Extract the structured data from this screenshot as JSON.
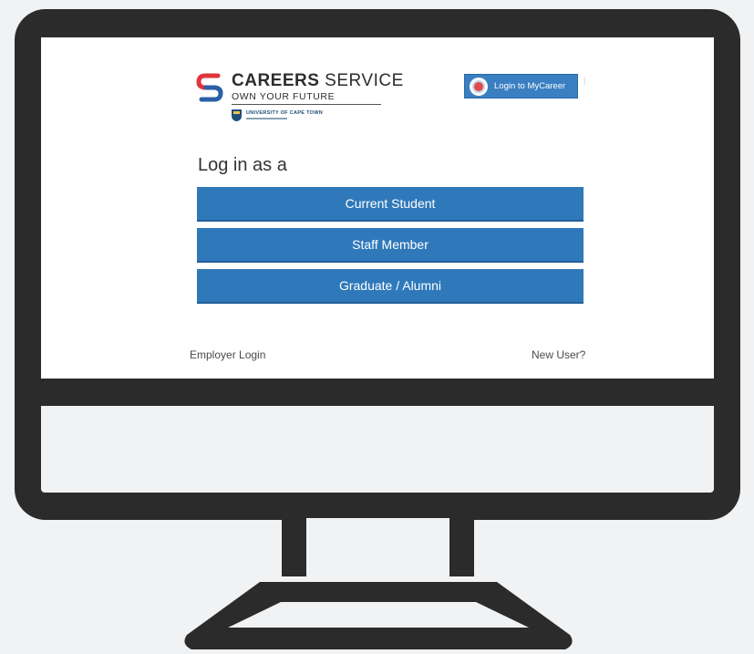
{
  "header": {
    "brand_bold": "CAREERS",
    "brand_light": " SERVICE",
    "tagline": "OWN YOUR FUTURE",
    "university": "UNIVERSITY OF CAPE TOWN",
    "mycareer_button": "Login to MyCareer"
  },
  "login": {
    "heading": "Log in as a",
    "roles": [
      "Current Student",
      "Staff Member",
      "Graduate / Alumni"
    ]
  },
  "footer": {
    "employer_login": "Employer Login",
    "new_user": "New User?"
  },
  "colors": {
    "button_blue": "#2f79ba",
    "monitor_frame": "#2c2b2b",
    "logo_red": "#e0333a",
    "logo_blue": "#2b5fa7"
  },
  "icons": {
    "logo": "careers-service-logo-icon",
    "crest": "uct-crest-icon",
    "badge": "mycareer-badge-icon"
  }
}
